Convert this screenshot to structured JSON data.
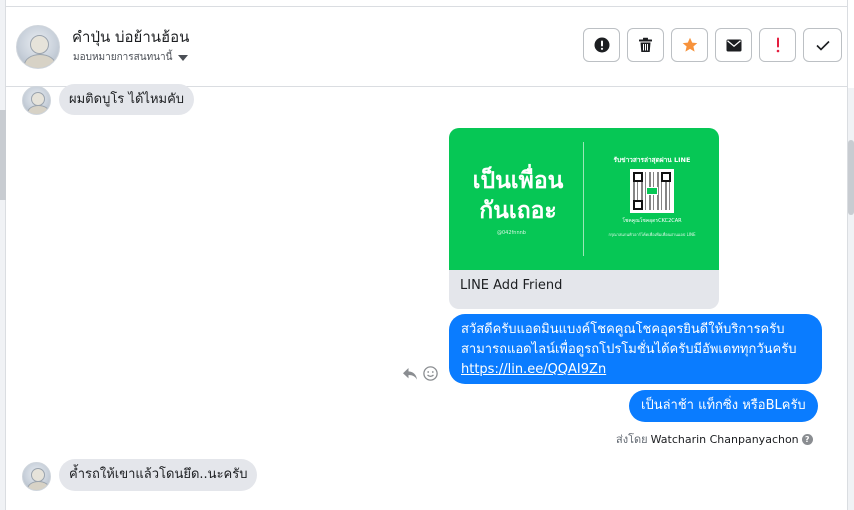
{
  "header": {
    "contact_name": "คำปุ่น บ่อย้านฮ้อน",
    "assign_label": "มอบหมายการสนทนานี้",
    "actions": [
      {
        "icon": "exclamation-circle-icon",
        "label": "mark as spam"
      },
      {
        "icon": "trash-icon",
        "label": "delete"
      },
      {
        "icon": "star-icon",
        "label": "star",
        "color": "#f7923b"
      },
      {
        "icon": "envelope-icon",
        "label": "mark as unread"
      },
      {
        "icon": "exclamation-icon",
        "label": "follow up",
        "color": "#e41e3f"
      },
      {
        "icon": "checkmark-icon",
        "label": "mark as done"
      }
    ]
  },
  "messages": {
    "incoming_1": "ผมติดบูโร ได้ไหมคับ",
    "card": {
      "headline_line1": "เป็นเพื่อน",
      "headline_line2": "กันเถอะ",
      "handle": "@042fnnnb",
      "right_title": "รับข่าวสารล่าสุดผ่าน LINE",
      "line_id": "โชคคูณโชคอุดรCKC2CAR",
      "note": "กรุณาสแกนคิวอาร์โค้ดเพื่อเพิ่มเพื่อนผ่านแอป LINE",
      "label": "LINE Add Friend"
    },
    "outgoing_1": {
      "line1": "สวัสดีครับแอดมินแบงค์โชคคูณโชคอุดรยินดีให้บริการครับ",
      "line2": "สามารถแอดไลน์เพื่อดูรถโปรโมชั่นได้ครับมีอัพเดททุกวันครับ",
      "link": "https://lin.ee/QQAI9Zn"
    },
    "outgoing_2": "เป็นล่าช้า แท็กซิ่ง หรือBLครับ",
    "sent_by_prefix": "ส่งโดย",
    "sent_by_name": "Watcharin Chanpanyachon",
    "incoming_2": "ค้ำรถให้เขาแล้วโดนยึด..นะครับ"
  },
  "colors": {
    "outgoing_bubble": "#0a7cff",
    "incoming_bubble": "#e4e6eb",
    "line_green": "#06c755"
  }
}
